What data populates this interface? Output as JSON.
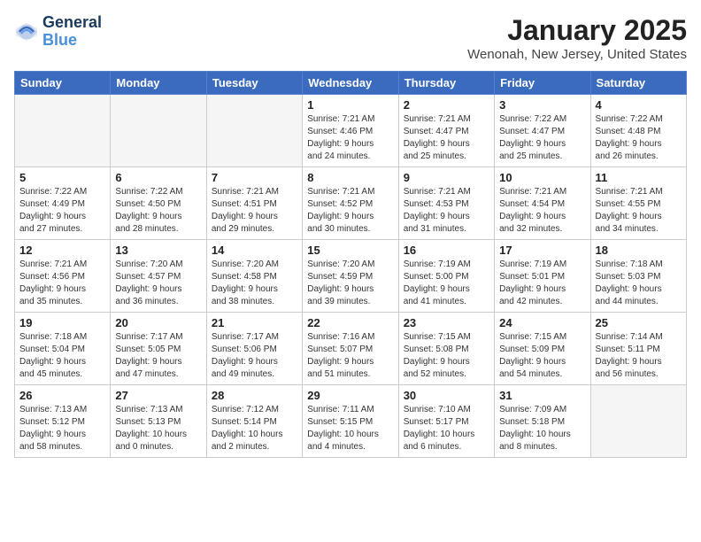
{
  "header": {
    "logo_line1": "General",
    "logo_line2": "Blue",
    "title": "January 2025",
    "subtitle": "Wenonah, New Jersey, United States"
  },
  "days_of_week": [
    "Sunday",
    "Monday",
    "Tuesday",
    "Wednesday",
    "Thursday",
    "Friday",
    "Saturday"
  ],
  "weeks": [
    [
      {
        "num": "",
        "info": ""
      },
      {
        "num": "",
        "info": ""
      },
      {
        "num": "",
        "info": ""
      },
      {
        "num": "1",
        "info": "Sunrise: 7:21 AM\nSunset: 4:46 PM\nDaylight: 9 hours\nand 24 minutes."
      },
      {
        "num": "2",
        "info": "Sunrise: 7:21 AM\nSunset: 4:47 PM\nDaylight: 9 hours\nand 25 minutes."
      },
      {
        "num": "3",
        "info": "Sunrise: 7:22 AM\nSunset: 4:47 PM\nDaylight: 9 hours\nand 25 minutes."
      },
      {
        "num": "4",
        "info": "Sunrise: 7:22 AM\nSunset: 4:48 PM\nDaylight: 9 hours\nand 26 minutes."
      }
    ],
    [
      {
        "num": "5",
        "info": "Sunrise: 7:22 AM\nSunset: 4:49 PM\nDaylight: 9 hours\nand 27 minutes."
      },
      {
        "num": "6",
        "info": "Sunrise: 7:22 AM\nSunset: 4:50 PM\nDaylight: 9 hours\nand 28 minutes."
      },
      {
        "num": "7",
        "info": "Sunrise: 7:21 AM\nSunset: 4:51 PM\nDaylight: 9 hours\nand 29 minutes."
      },
      {
        "num": "8",
        "info": "Sunrise: 7:21 AM\nSunset: 4:52 PM\nDaylight: 9 hours\nand 30 minutes."
      },
      {
        "num": "9",
        "info": "Sunrise: 7:21 AM\nSunset: 4:53 PM\nDaylight: 9 hours\nand 31 minutes."
      },
      {
        "num": "10",
        "info": "Sunrise: 7:21 AM\nSunset: 4:54 PM\nDaylight: 9 hours\nand 32 minutes."
      },
      {
        "num": "11",
        "info": "Sunrise: 7:21 AM\nSunset: 4:55 PM\nDaylight: 9 hours\nand 34 minutes."
      }
    ],
    [
      {
        "num": "12",
        "info": "Sunrise: 7:21 AM\nSunset: 4:56 PM\nDaylight: 9 hours\nand 35 minutes."
      },
      {
        "num": "13",
        "info": "Sunrise: 7:20 AM\nSunset: 4:57 PM\nDaylight: 9 hours\nand 36 minutes."
      },
      {
        "num": "14",
        "info": "Sunrise: 7:20 AM\nSunset: 4:58 PM\nDaylight: 9 hours\nand 38 minutes."
      },
      {
        "num": "15",
        "info": "Sunrise: 7:20 AM\nSunset: 4:59 PM\nDaylight: 9 hours\nand 39 minutes."
      },
      {
        "num": "16",
        "info": "Sunrise: 7:19 AM\nSunset: 5:00 PM\nDaylight: 9 hours\nand 41 minutes."
      },
      {
        "num": "17",
        "info": "Sunrise: 7:19 AM\nSunset: 5:01 PM\nDaylight: 9 hours\nand 42 minutes."
      },
      {
        "num": "18",
        "info": "Sunrise: 7:18 AM\nSunset: 5:03 PM\nDaylight: 9 hours\nand 44 minutes."
      }
    ],
    [
      {
        "num": "19",
        "info": "Sunrise: 7:18 AM\nSunset: 5:04 PM\nDaylight: 9 hours\nand 45 minutes."
      },
      {
        "num": "20",
        "info": "Sunrise: 7:17 AM\nSunset: 5:05 PM\nDaylight: 9 hours\nand 47 minutes."
      },
      {
        "num": "21",
        "info": "Sunrise: 7:17 AM\nSunset: 5:06 PM\nDaylight: 9 hours\nand 49 minutes."
      },
      {
        "num": "22",
        "info": "Sunrise: 7:16 AM\nSunset: 5:07 PM\nDaylight: 9 hours\nand 51 minutes."
      },
      {
        "num": "23",
        "info": "Sunrise: 7:15 AM\nSunset: 5:08 PM\nDaylight: 9 hours\nand 52 minutes."
      },
      {
        "num": "24",
        "info": "Sunrise: 7:15 AM\nSunset: 5:09 PM\nDaylight: 9 hours\nand 54 minutes."
      },
      {
        "num": "25",
        "info": "Sunrise: 7:14 AM\nSunset: 5:11 PM\nDaylight: 9 hours\nand 56 minutes."
      }
    ],
    [
      {
        "num": "26",
        "info": "Sunrise: 7:13 AM\nSunset: 5:12 PM\nDaylight: 9 hours\nand 58 minutes."
      },
      {
        "num": "27",
        "info": "Sunrise: 7:13 AM\nSunset: 5:13 PM\nDaylight: 10 hours\nand 0 minutes."
      },
      {
        "num": "28",
        "info": "Sunrise: 7:12 AM\nSunset: 5:14 PM\nDaylight: 10 hours\nand 2 minutes."
      },
      {
        "num": "29",
        "info": "Sunrise: 7:11 AM\nSunset: 5:15 PM\nDaylight: 10 hours\nand 4 minutes."
      },
      {
        "num": "30",
        "info": "Sunrise: 7:10 AM\nSunset: 5:17 PM\nDaylight: 10 hours\nand 6 minutes."
      },
      {
        "num": "31",
        "info": "Sunrise: 7:09 AM\nSunset: 5:18 PM\nDaylight: 10 hours\nand 8 minutes."
      },
      {
        "num": "",
        "info": ""
      }
    ]
  ]
}
